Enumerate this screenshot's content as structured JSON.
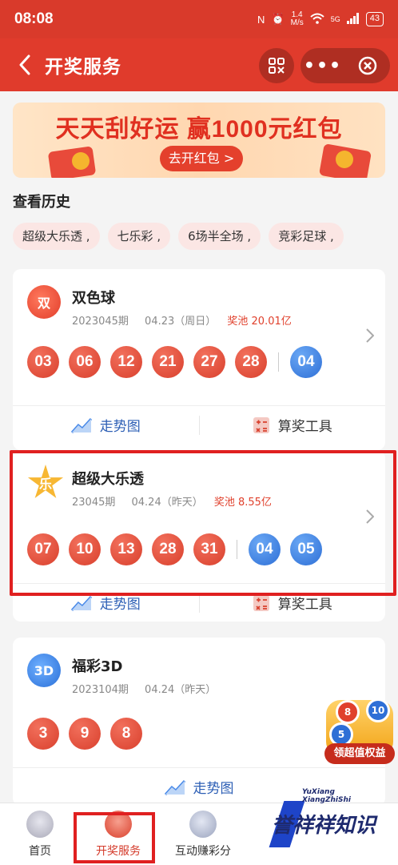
{
  "status": {
    "time": "08:08",
    "speed_value": "1.4",
    "speed_unit": "M/s",
    "network": "5G",
    "battery": "43"
  },
  "nav": {
    "title": "开奖服务"
  },
  "banner": {
    "title": "天天刮好运 赢1000元红包",
    "button": "去开红包 >"
  },
  "history": {
    "title": "查看历史",
    "chips": [
      "超级大乐透 ,",
      "七乐彩 ,",
      "6场半全场 ,",
      "竞彩足球 ,"
    ]
  },
  "lotteries": [
    {
      "name": "双色球",
      "logo_text": "双",
      "period": "2023045期",
      "date": "04.23（周日）",
      "pool": "奖池 20.01亿",
      "red": [
        "03",
        "06",
        "12",
        "21",
        "27",
        "28"
      ],
      "blue": [
        "04"
      ],
      "trend": "走势图",
      "tool": "算奖工具"
    },
    {
      "name": "超级大乐透",
      "logo_text": "乐",
      "period": "23045期",
      "date": "04.24（昨天）",
      "pool": "奖池 8.55亿",
      "red": [
        "07",
        "10",
        "13",
        "28",
        "31"
      ],
      "blue": [
        "04",
        "05"
      ],
      "trend": "走势图",
      "tool": "算奖工具"
    },
    {
      "name": "福彩3D",
      "logo_text": "3D",
      "period": "2023104期",
      "date": "04.24（昨天）",
      "red": [
        "3",
        "9",
        "8"
      ],
      "trend": "走势图"
    }
  ],
  "float_badge": {
    "label": "领超值权益",
    "balls": [
      "8",
      "10",
      "5"
    ]
  },
  "tabbar": {
    "tabs": [
      "首页",
      "开奖服务",
      "互动赚彩分"
    ],
    "active_index": 1
  },
  "watermark": {
    "en_line1": "YuXiang",
    "en_line2": "XiangZhiShi",
    "cn": "誉祥祥知识"
  },
  "colors": {
    "brand_red": "#e03b2c",
    "ball_red": "#d9402d",
    "ball_blue": "#2e6fd6",
    "pool_red": "#e0402c",
    "highlight": "#e02020"
  }
}
